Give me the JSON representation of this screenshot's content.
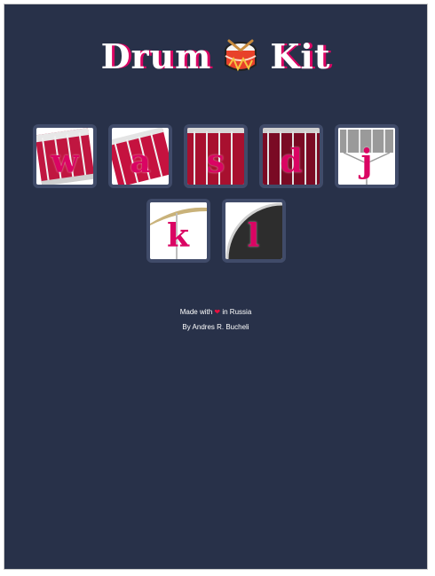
{
  "header": {
    "title_left": "Drum",
    "title_right": "Kit",
    "icon": "drum-icon"
  },
  "keys": [
    {
      "letter": "w",
      "sound": "snare-drum"
    },
    {
      "letter": "a",
      "sound": "tom-drum"
    },
    {
      "letter": "s",
      "sound": "floor-tom"
    },
    {
      "letter": "d",
      "sound": "tom-dark"
    },
    {
      "letter": "j",
      "sound": "snare-silver"
    },
    {
      "letter": "k",
      "sound": "cymbal"
    },
    {
      "letter": "l",
      "sound": "kick-drum"
    }
  ],
  "footer": {
    "made_with": "Made with",
    "heart_icon": "heart-icon",
    "in_place": "in Russia",
    "author": "By Andres R. Bucheli"
  },
  "colors": {
    "background": "#283149",
    "key_border": "#404b69",
    "accent": "#da0463"
  }
}
